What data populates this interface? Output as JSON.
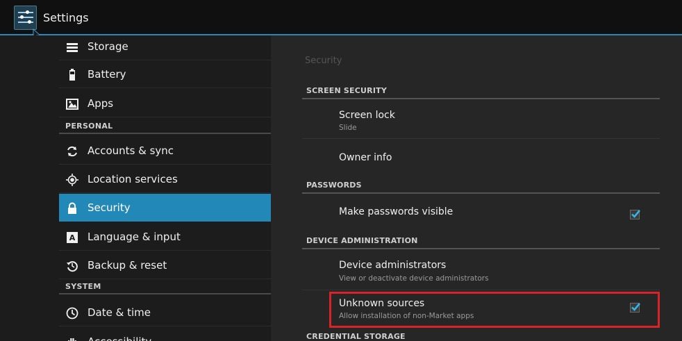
{
  "actionbar": {
    "title": "Settings",
    "icon": "settings-sliders-icon"
  },
  "sidebar": {
    "items": [
      {
        "label": "Storage",
        "icon": "storage-icon"
      },
      {
        "label": "Battery",
        "icon": "battery-icon"
      },
      {
        "label": "Apps",
        "icon": "apps-icon"
      },
      {
        "label": "Accounts & sync",
        "icon": "sync-icon"
      },
      {
        "label": "Location services",
        "icon": "location-icon"
      },
      {
        "label": "Security",
        "icon": "lock-icon",
        "selected": true
      },
      {
        "label": "Language & input",
        "icon": "language-icon"
      },
      {
        "label": "Backup & reset",
        "icon": "backup-icon"
      },
      {
        "label": "Date & time",
        "icon": "clock-icon"
      },
      {
        "label": "Accessibility",
        "icon": "hand-icon"
      }
    ],
    "sections": {
      "personal": "PERSONAL",
      "system": "SYSTEM"
    }
  },
  "detail": {
    "title": "Security",
    "sections": {
      "screen_security": "SCREEN SECURITY",
      "passwords": "PASSWORDS",
      "device_admin": "DEVICE ADMINISTRATION",
      "credential_storage": "CREDENTIAL STORAGE"
    },
    "screen_lock": {
      "title": "Screen lock",
      "summary": "Slide"
    },
    "owner_info": {
      "title": "Owner info"
    },
    "make_passwords_visible": {
      "title": "Make passwords visible",
      "checked": true
    },
    "device_administrators": {
      "title": "Device administrators",
      "summary": "View or deactivate device administrators"
    },
    "unknown_sources": {
      "title": "Unknown sources",
      "summary": "Allow installation of non-Market apps",
      "checked": true
    }
  },
  "colors": {
    "accent": "#2288b8",
    "highlight": "#d9232b",
    "check": "#33b5e5"
  }
}
